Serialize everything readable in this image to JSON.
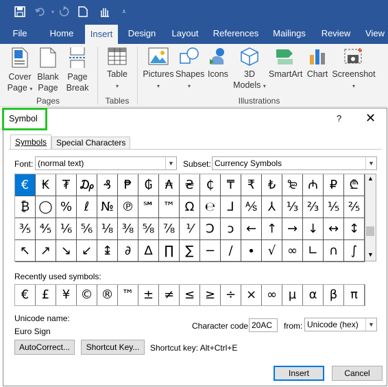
{
  "quick_access": {
    "icons": [
      "save-icon",
      "undo-icon",
      "redo-icon",
      "new-doc-icon",
      "touch-mode-icon",
      "customize-icon"
    ]
  },
  "tabs": [
    "File",
    "Home",
    "Insert",
    "Design",
    "Layout",
    "References",
    "Mailings",
    "Review",
    "View"
  ],
  "active_tab": "Insert",
  "ribbon": {
    "buttons": {
      "cover_line1": "Cover",
      "cover_line2": "Page",
      "blank_line1": "Blank",
      "blank_line2": "Page",
      "break_line1": "Page",
      "break_line2": "Break",
      "table": "Table",
      "pictures": "Pictures",
      "shapes": "Shapes",
      "icons": "Icons",
      "models_line1": "3D",
      "models_line2": "Models",
      "smartart": "SmartArt",
      "chart": "Chart",
      "screenshot": "Screenshot"
    },
    "groups": {
      "pages": "Pages",
      "tables": "Tables",
      "illustrations": "Illustrations"
    }
  },
  "dialog": {
    "title": "Symbol",
    "help": "?",
    "close": "✕",
    "tab_symbols": "Symbols",
    "tab_special": "Special Characters",
    "font_label": "Font:",
    "font_value": "(normal text)",
    "subset_label": "Subset:",
    "subset_value": "Currency Symbols",
    "symbols": [
      [
        "€",
        "₭",
        "₮",
        "₯",
        "₰",
        "₱",
        "₲",
        "₳",
        "₴",
        "₵",
        "₸",
        "₹",
        "₺",
        "₻",
        "₼",
        "₽",
        "₾"
      ],
      [
        "₿",
        "◯",
        "%",
        "ℓ",
        "№",
        "℗",
        "℠",
        "™",
        "Ω",
        "℮",
        "⅃",
        "⅍",
        "⅄",
        "⅓",
        "⅔",
        "⅕",
        "⅖"
      ],
      [
        "⅗",
        "⅘",
        "⅙",
        "⅚",
        "⅛",
        "⅜",
        "⅝",
        "⅞",
        "⅟",
        "Ↄ",
        "ↄ",
        "←",
        "↑",
        "→",
        "↓",
        "↔",
        "↕"
      ],
      [
        "↖",
        "↗",
        "↘",
        "↙",
        "↨",
        "∂",
        "∆",
        "∏",
        "∑",
        "−",
        "∕",
        "∙",
        "√",
        "∞",
        "∟",
        "∩",
        "∫"
      ]
    ],
    "selected_symbol": "€",
    "recent_label": "Recently used symbols:",
    "recent": [
      "€",
      "£",
      "¥",
      "©",
      "®",
      "™",
      "±",
      "≠",
      "≤",
      "≥",
      "÷",
      "×",
      "∞",
      "µ",
      "α",
      "β",
      "π"
    ],
    "unicode_name_label": "Unicode name:",
    "unicode_name": "Euro Sign",
    "char_code_label": "Character code:",
    "char_code": "20AC",
    "from_label": "from:",
    "from_value": "Unicode (hex)",
    "autocorrect_btn": "AutoCorrect...",
    "shortcut_btn": "Shortcut Key...",
    "shortcut_text": "Shortcut key: Alt+Ctrl+E",
    "insert_btn": "Insert",
    "cancel_btn": "Cancel"
  },
  "colors": {
    "title_bar": "#2b579a",
    "ribbon_bg": "#f3f3f3",
    "selection": "#0078d7",
    "highlight": "#25c425"
  }
}
